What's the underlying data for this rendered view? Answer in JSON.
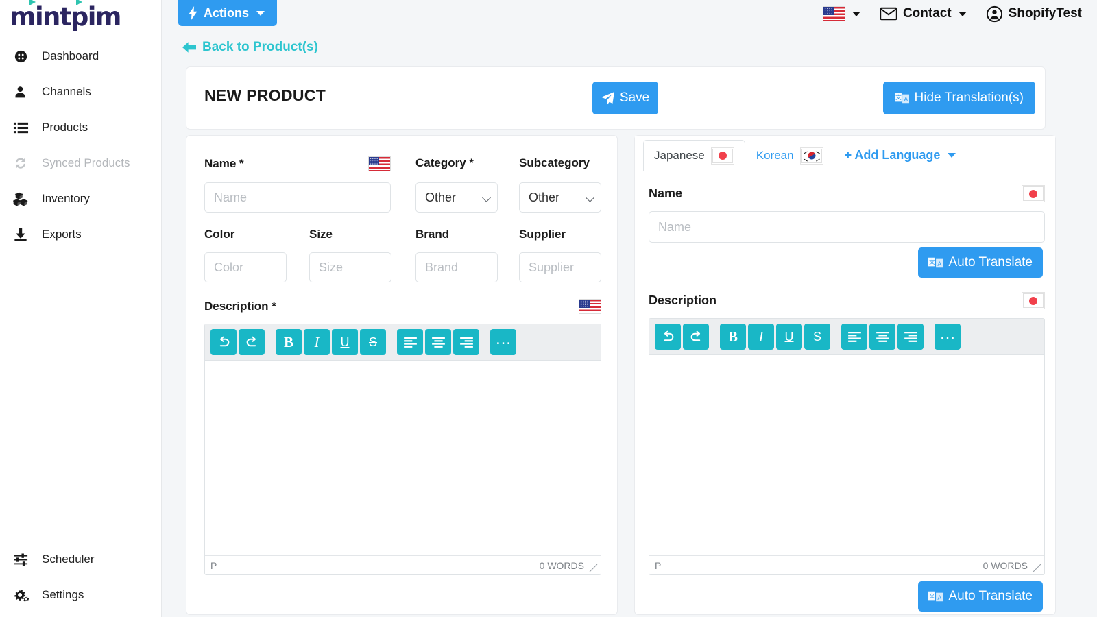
{
  "brand": {
    "logo_text": "mintpim"
  },
  "colors": {
    "brand_navy": "#2b2560",
    "brand_green": "#2ec4b0",
    "accent_blue": "#2f9bf0",
    "accent_teal": "#19b7c6",
    "link_teal": "#2dc5cf",
    "page_bg": "#f4f6f8"
  },
  "sidebar": {
    "items": [
      {
        "label": "Dashboard",
        "icon": "dashboard-icon",
        "disabled": false
      },
      {
        "label": "Channels",
        "icon": "user-icon",
        "disabled": false
      },
      {
        "label": "Products",
        "icon": "list-icon",
        "disabled": false
      },
      {
        "label": "Synced Products",
        "icon": "sync-icon",
        "disabled": true
      },
      {
        "label": "Inventory",
        "icon": "boxes-icon",
        "disabled": false
      },
      {
        "label": "Exports",
        "icon": "download-icon",
        "disabled": false
      }
    ],
    "bottom_items": [
      {
        "label": "Scheduler",
        "icon": "sliders-icon"
      },
      {
        "label": "Settings",
        "icon": "cogs-icon"
      }
    ]
  },
  "topbar": {
    "language_flag": "us-flag-icon",
    "contact_label": "Contact",
    "contact_icon": "envelope-icon",
    "user_label": "ShopifyTest",
    "user_icon": "user-circle-icon"
  },
  "actions_button": {
    "label": "Actions",
    "icon": "bolt-icon"
  },
  "back_link": {
    "label": "Back to Product(s)",
    "icon": "arrow-left-icon"
  },
  "header": {
    "title": "NEW PRODUCT",
    "save_label": "Save",
    "save_icon": "paper-plane-icon",
    "hide_translations_label": "Hide Translation(s)",
    "hide_translations_icon": "translate-icon"
  },
  "form": {
    "flag_icon": "us-flag-icon",
    "name": {
      "label": "Name *",
      "placeholder": "Name",
      "value": ""
    },
    "category": {
      "label": "Category *",
      "value": "Other",
      "options": [
        "Other"
      ]
    },
    "subcategory": {
      "label": "Subcategory",
      "value": "Other",
      "options": [
        "Other"
      ]
    },
    "color": {
      "label": "Color",
      "placeholder": "Color",
      "value": ""
    },
    "size": {
      "label": "Size",
      "placeholder": "Size",
      "value": ""
    },
    "brand": {
      "label": "Brand",
      "placeholder": "Brand",
      "value": ""
    },
    "supplier": {
      "label": "Supplier",
      "placeholder": "Supplier",
      "value": ""
    },
    "description": {
      "label": "Description *",
      "value": ""
    }
  },
  "editor": {
    "toolbar": [
      {
        "name": "undo-icon",
        "glyph": "↶"
      },
      {
        "name": "redo-icon",
        "glyph": "↷"
      },
      {
        "name": "bold-icon",
        "glyph": "B"
      },
      {
        "name": "italic-icon",
        "glyph": "I"
      },
      {
        "name": "underline-icon",
        "glyph": "U"
      },
      {
        "name": "strikethrough-icon",
        "glyph": "S"
      },
      {
        "name": "align-left-icon",
        "glyph": "≡"
      },
      {
        "name": "align-center-icon",
        "glyph": "≡"
      },
      {
        "name": "align-right-icon",
        "glyph": "≡"
      },
      {
        "name": "more-options-icon",
        "glyph": "…"
      }
    ],
    "status_tag": "P",
    "word_count": "0 WORDS"
  },
  "translation_panel": {
    "tabs": [
      {
        "label": "Japanese",
        "flag": "jp-flag-icon",
        "active": true
      },
      {
        "label": "Korean",
        "flag": "kr-flag-icon",
        "active": false
      }
    ],
    "add_language_label": "+ Add Language",
    "name": {
      "label": "Name",
      "placeholder": "Name",
      "value": "",
      "flag": "jp-flag-icon"
    },
    "description": {
      "label": "Description",
      "value": "",
      "flag": "jp-flag-icon"
    },
    "auto_translate_label": "Auto Translate",
    "auto_translate_icon": "translate-icon"
  }
}
